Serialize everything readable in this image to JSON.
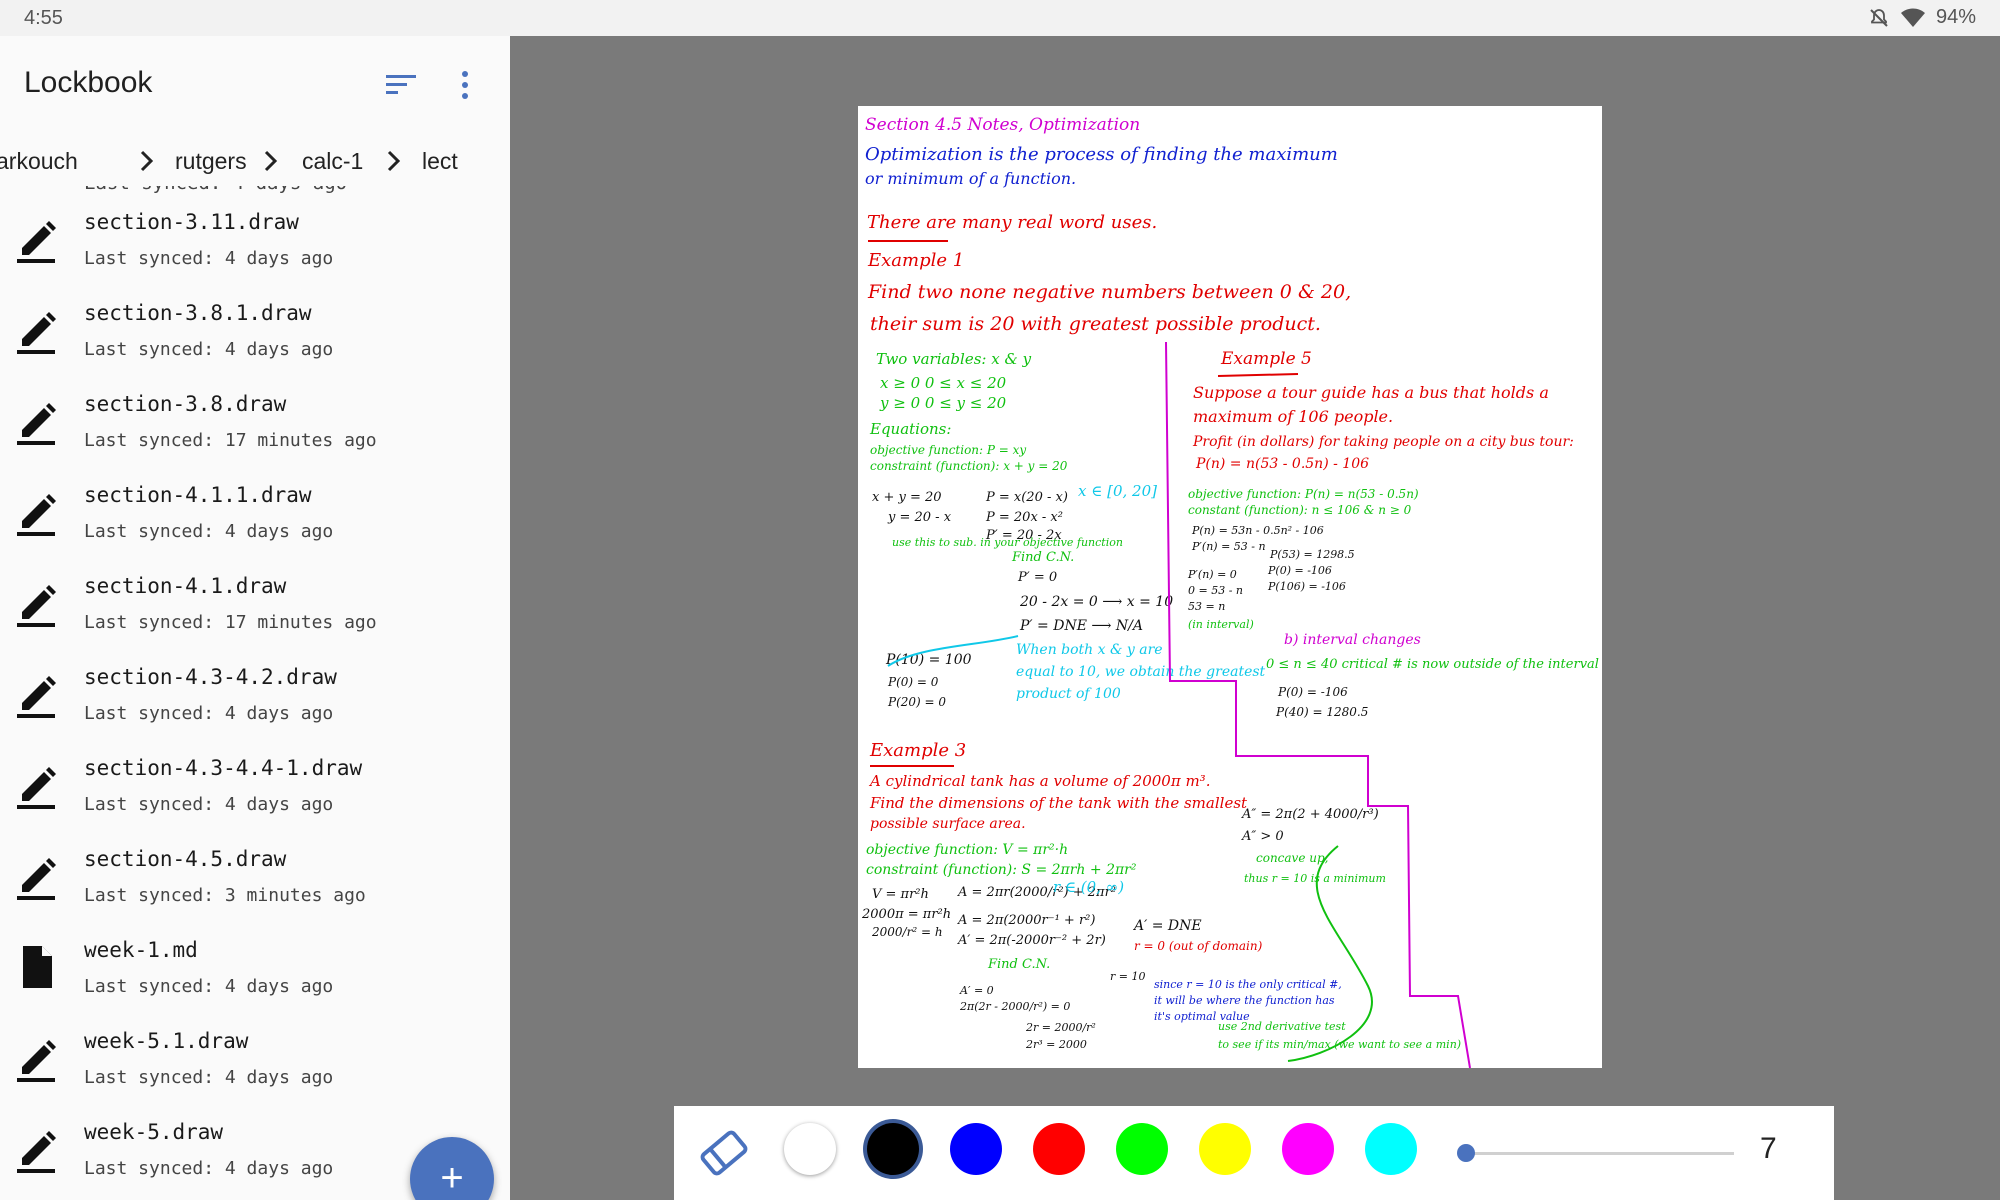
{
  "status": {
    "time": "4:55",
    "battery": "94%",
    "icons": [
      "notifications-off-icon",
      "wifi-icon"
    ]
  },
  "app": {
    "title": "Lockbook"
  },
  "breadcrumb": [
    {
      "label": "arkouch"
    },
    {
      "label": "rutgers"
    },
    {
      "label": "calc-1"
    },
    {
      "label": "lect"
    }
  ],
  "partial_row_text": "Last synced: 4 days ago",
  "files": [
    {
      "name": "section-3.11.draw",
      "synced": "Last synced: 4 days ago",
      "icon": "draw-icon"
    },
    {
      "name": "section-3.8.1.draw",
      "synced": "Last synced: 4 days ago",
      "icon": "draw-icon"
    },
    {
      "name": "section-3.8.draw",
      "synced": "Last synced: 17 minutes ago",
      "icon": "draw-icon"
    },
    {
      "name": "section-4.1.1.draw",
      "synced": "Last synced: 4 days ago",
      "icon": "draw-icon"
    },
    {
      "name": "section-4.1.draw",
      "synced": "Last synced: 17 minutes ago",
      "icon": "draw-icon"
    },
    {
      "name": "section-4.3-4.2.draw",
      "synced": "Last synced: 4 days ago",
      "icon": "draw-icon"
    },
    {
      "name": "section-4.3-4.4-1.draw",
      "synced": "Last synced: 4 days ago",
      "icon": "draw-icon"
    },
    {
      "name": "section-4.5.draw",
      "synced": "Last synced: 3 minutes ago",
      "icon": "draw-icon"
    },
    {
      "name": "week-1.md",
      "synced": "Last synced: 4 days ago",
      "icon": "document-icon"
    },
    {
      "name": "week-5.1.draw",
      "synced": "Last synced: 4 days ago",
      "icon": "draw-icon"
    },
    {
      "name": "week-5.draw",
      "synced": "Last synced: 4 days ago",
      "icon": "draw-icon"
    }
  ],
  "fab": {
    "label": "+"
  },
  "toolbar": {
    "colors": [
      {
        "name": "white",
        "hex": "#ffffff"
      },
      {
        "name": "black",
        "hex": "#000000",
        "selected": true
      },
      {
        "name": "blue",
        "hex": "#0000ff"
      },
      {
        "name": "red",
        "hex": "#ff0000"
      },
      {
        "name": "green",
        "hex": "#00ff00"
      },
      {
        "name": "yellow",
        "hex": "#ffff00"
      },
      {
        "name": "magenta",
        "hex": "#ff00ff"
      },
      {
        "name": "cyan",
        "hex": "#00ffff"
      }
    ],
    "stroke_width": "7"
  },
  "note": {
    "colors": {
      "magenta": "#d000d0",
      "blue": "#1020d0",
      "red": "#e00000",
      "green": "#10c010",
      "cyan": "#10c8e8",
      "black": "#111111"
    },
    "lines": [
      {
        "text": "Section 4.5 Notes, Optimization",
        "color": "magenta"
      },
      {
        "text": "Optimization is the process of finding the maximum",
        "color": "blue"
      },
      {
        "text": "or minimum of a function.",
        "color": "blue"
      },
      {
        "text": "There are many real word uses.",
        "color": "red"
      },
      {
        "text": "Example 1",
        "color": "red"
      },
      {
        "text": "Find two none negative numbers between 0 & 20,",
        "color": "red"
      },
      {
        "text": "their sum is 20 with greatest possible product.",
        "color": "red"
      },
      {
        "text": "Two variables: x & y",
        "color": "green"
      },
      {
        "text": "x ≥ 0   0 ≤ x ≤ 20",
        "color": "green"
      },
      {
        "text": "y ≥ 0   0 ≤ y ≤ 20",
        "color": "green"
      },
      {
        "text": "Equations:",
        "color": "green"
      },
      {
        "text": "objective function: P = xy",
        "color": "green"
      },
      {
        "text": "constraint (function): x + y = 20",
        "color": "green"
      },
      {
        "text": "x + y = 20",
        "color": "black"
      },
      {
        "text": "y = 20 - x",
        "color": "black"
      },
      {
        "text": "use this to sub. in your objective function",
        "color": "green"
      },
      {
        "text": "P = x(20 - x)",
        "color": "black"
      },
      {
        "text": "P = 20x - x²",
        "color": "black"
      },
      {
        "text": "P′ = 20 - 2x",
        "color": "black"
      },
      {
        "text": "x ∈ [0, 20]",
        "color": "cyan"
      },
      {
        "text": "Find C.N.",
        "color": "green"
      },
      {
        "text": "P′ = 0",
        "color": "black"
      },
      {
        "text": "20 - 2x = 0 ⟶ x = 10",
        "color": "black"
      },
      {
        "text": "P′ = DNE ⟶ N/A",
        "color": "black"
      },
      {
        "text": "P(10) = 100",
        "color": "black"
      },
      {
        "text": "P(0) = 0",
        "color": "black"
      },
      {
        "text": "P(20) = 0",
        "color": "black"
      },
      {
        "text": "When both x & y are",
        "color": "cyan"
      },
      {
        "text": "equal to 10, we obtain the greatest",
        "color": "cyan"
      },
      {
        "text": "product of 100",
        "color": "cyan"
      },
      {
        "text": "Example 5",
        "color": "red"
      },
      {
        "text": "Suppose a tour guide has a bus that holds a",
        "color": "red"
      },
      {
        "text": "maximum of 106 people.",
        "color": "red"
      },
      {
        "text": "Profit (in dollars) for taking people on a city bus tour:",
        "color": "red"
      },
      {
        "text": "P(n) = n(53 - 0.5n) - 106",
        "color": "red"
      },
      {
        "text": "objective function: P(n) = n(53 - 0.5n)",
        "color": "green"
      },
      {
        "text": "constant (function): n ≤ 106 & n ≥ 0",
        "color": "green"
      },
      {
        "text": "P(n) = 53n - 0.5n² - 106",
        "color": "black"
      },
      {
        "text": "P′(n) = 53 - n",
        "color": "black"
      },
      {
        "text": "P′(n) = 0",
        "color": "black"
      },
      {
        "text": "0 = 53 - n",
        "color": "black"
      },
      {
        "text": "53 = n",
        "color": "black"
      },
      {
        "text": "(in interval)",
        "color": "green"
      },
      {
        "text": "P(53) = 1298.5",
        "color": "black"
      },
      {
        "text": "P(0) = -106",
        "color": "black"
      },
      {
        "text": "P(106) = -106",
        "color": "black"
      },
      {
        "text": "b) interval changes",
        "color": "magenta"
      },
      {
        "text": "0 ≤ n ≤ 40   critical # is now outside of the interval",
        "color": "green"
      },
      {
        "text": "P(0) = -106",
        "color": "black"
      },
      {
        "text": "P(40) = 1280.5",
        "color": "black"
      },
      {
        "text": "Example 3",
        "color": "red"
      },
      {
        "text": "A cylindrical tank has a volume of 2000π m³.",
        "color": "red"
      },
      {
        "text": "Find the dimensions of the tank with the smallest",
        "color": "red"
      },
      {
        "text": "possible surface area.",
        "color": "red"
      },
      {
        "text": "objective function: V = πr²·h",
        "color": "green"
      },
      {
        "text": "constraint (function): S = 2πrh + 2πr²",
        "color": "green"
      },
      {
        "text": "V = πr²h",
        "color": "black"
      },
      {
        "text": "2000π = πr²h",
        "color": "black"
      },
      {
        "text": "2000/r² = h",
        "color": "black"
      },
      {
        "text": "A = 2πr(2000/r²) + 2πr²",
        "color": "black"
      },
      {
        "text": "r ∈ (0, ∞)",
        "color": "cyan"
      },
      {
        "text": "A = 2π(2000r⁻¹ + r²)",
        "color": "black"
      },
      {
        "text": "A′ = 2π(-2000r⁻² + 2r)",
        "color": "black"
      },
      {
        "text": "Find C.N.",
        "color": "green"
      },
      {
        "text": "A′ = 0",
        "color": "black"
      },
      {
        "text": "2π(2r - 2000/r²) = 0",
        "color": "black"
      },
      {
        "text": "2r = 2000/r²",
        "color": "black"
      },
      {
        "text": "2r³ = 2000",
        "color": "black"
      },
      {
        "text": "r = 10",
        "color": "black"
      },
      {
        "text": "A′ = DNE",
        "color": "black"
      },
      {
        "text": "r = 0 (out of domain)",
        "color": "red"
      },
      {
        "text": "A″ = 2π(2 + 4000/r³)",
        "color": "black"
      },
      {
        "text": "A″ > 0",
        "color": "black"
      },
      {
        "text": "concave up,",
        "color": "green"
      },
      {
        "text": "thus r = 10 is a minimum",
        "color": "green"
      },
      {
        "text": "since r = 10 is the only critical #,",
        "color": "blue"
      },
      {
        "text": "it will be where the function has",
        "color": "blue"
      },
      {
        "text": "it's optimal value",
        "color": "blue"
      },
      {
        "text": "use 2nd derivative test",
        "color": "green"
      },
      {
        "text": "to see if its min/max (we want to see a min)",
        "color": "green"
      }
    ]
  }
}
